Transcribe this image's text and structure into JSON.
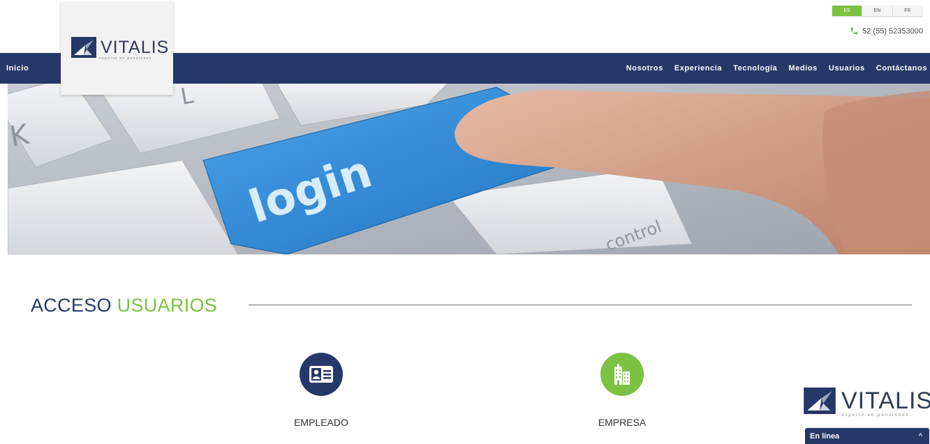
{
  "header": {
    "languages": [
      {
        "code": "ES",
        "active": true
      },
      {
        "code": "EN",
        "active": false
      },
      {
        "code": "FR",
        "active": false
      }
    ],
    "phone_icon": "phone-icon",
    "phone": "52 (55) 52353000",
    "logo_text": "VITALIS",
    "logo_tagline": "experto en pensiones"
  },
  "nav": {
    "home": "Inicio",
    "items": [
      "Nosotros",
      "Experiencia",
      "Tecnología",
      "Medios",
      "Usuarios",
      "Contáctanos"
    ]
  },
  "hero": {
    "key_label": "login",
    "key_control_label": "control",
    "key_k": "K",
    "key_l": "L"
  },
  "section": {
    "title_part1": "ACCESO",
    "title_part2": "USUARIOS"
  },
  "options": [
    {
      "label": "EMPLEADO",
      "icon": "id-card-icon"
    },
    {
      "label": "EMPRESA",
      "icon": "buildings-icon"
    }
  ],
  "chat": {
    "logo_text": "VITALIS",
    "logo_tagline": "experto en pensiones",
    "status": "En línea",
    "caret_icon": "chevron-up-icon"
  },
  "colors": {
    "navy": "#253868",
    "green": "#7cc242",
    "key_blue": "#2f8fd8"
  }
}
